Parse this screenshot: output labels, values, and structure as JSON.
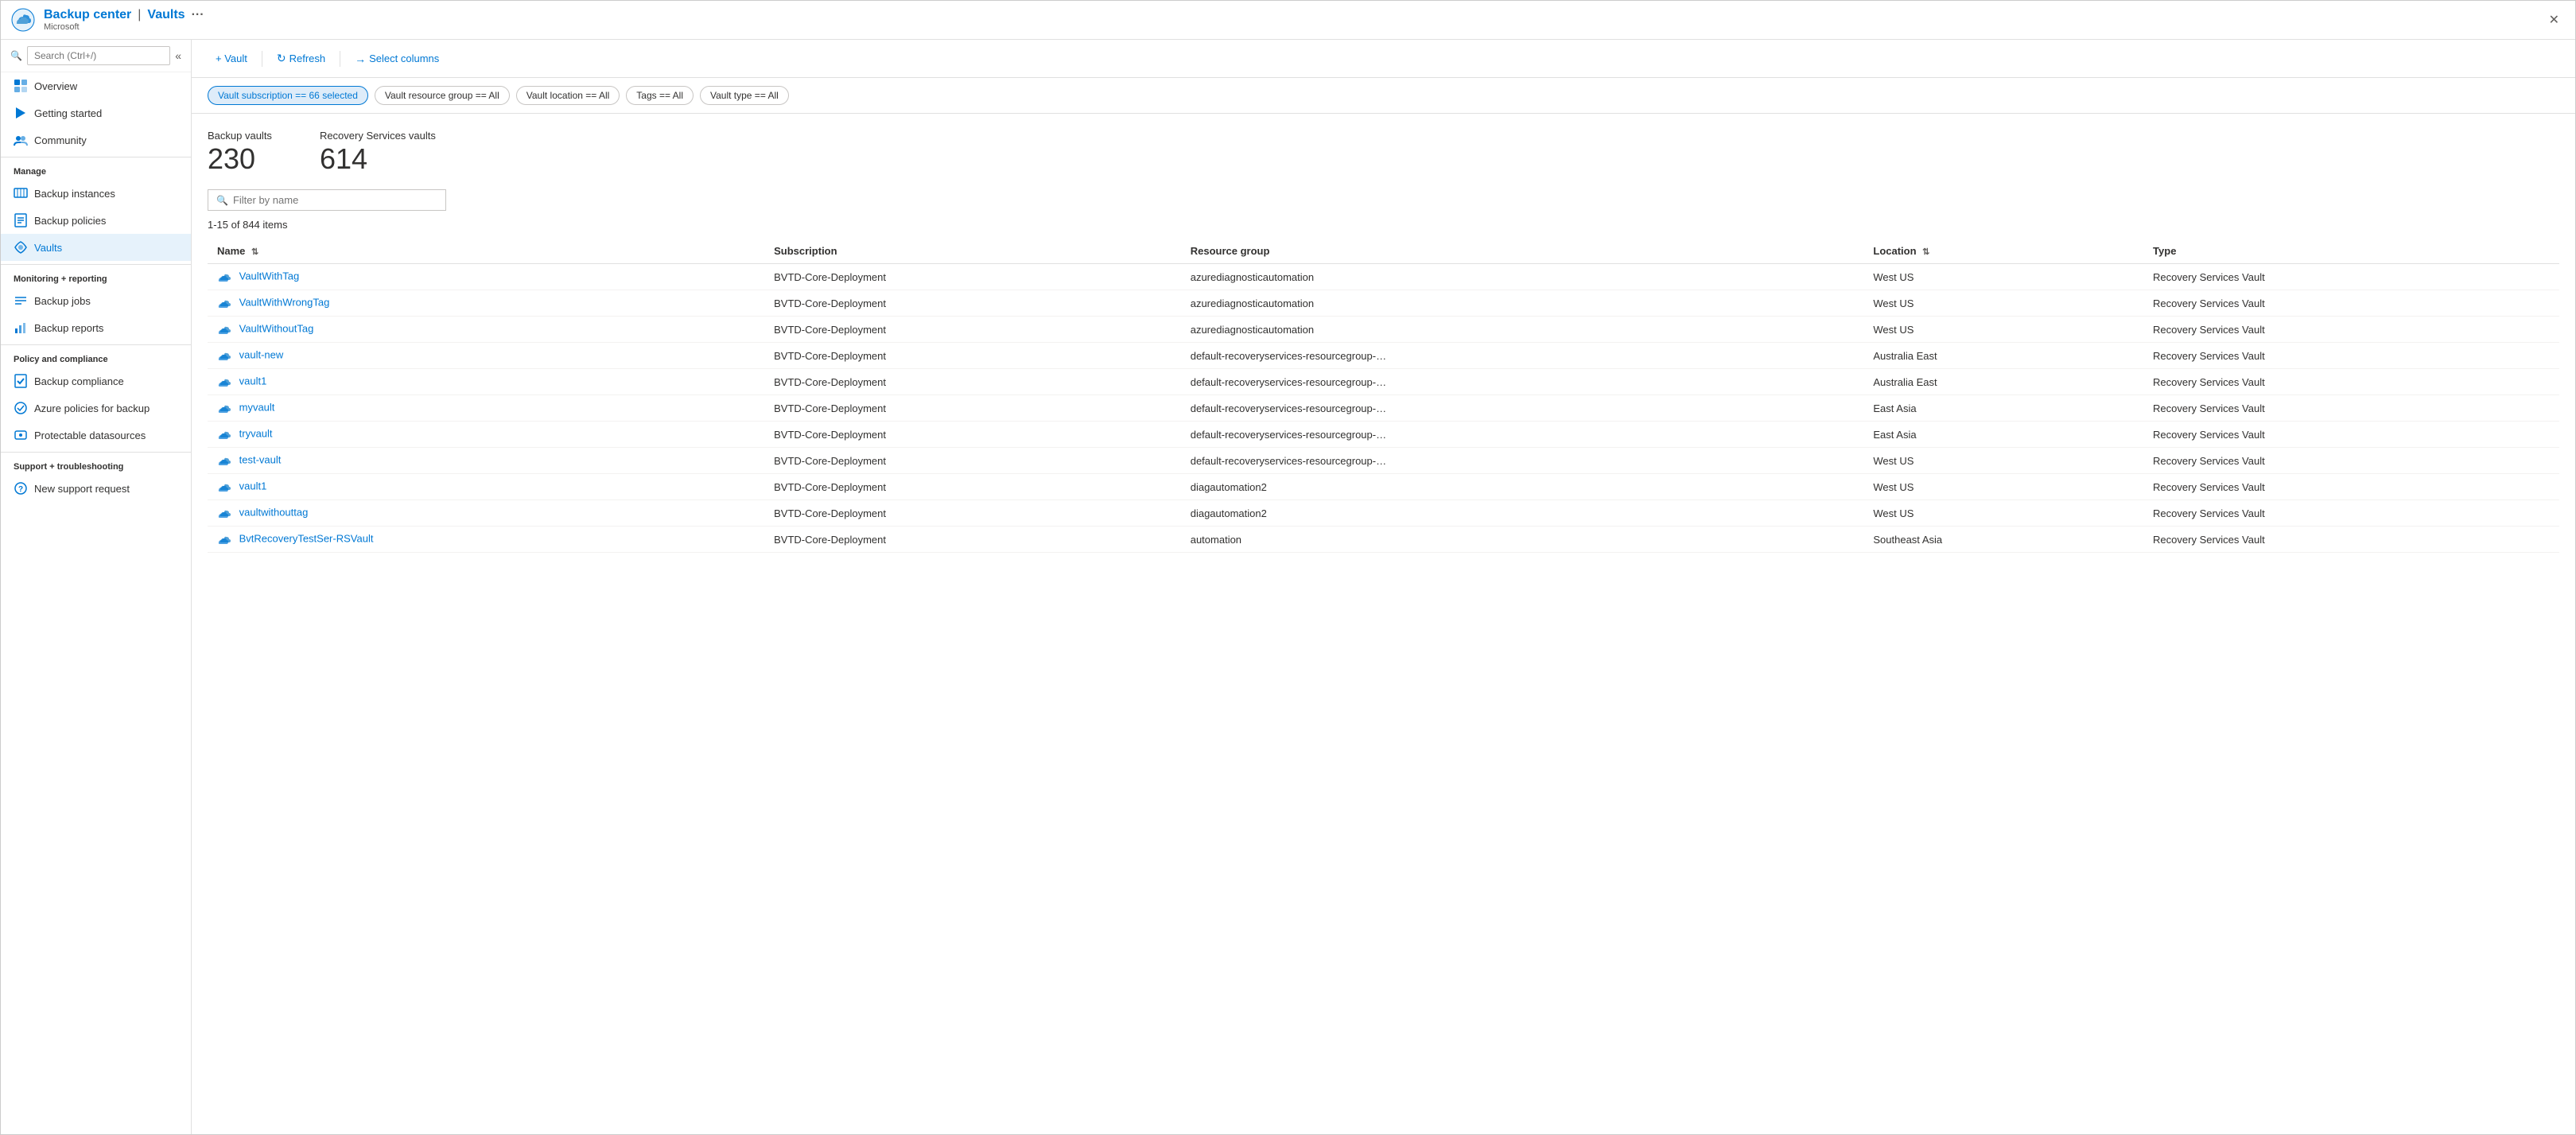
{
  "titleBar": {
    "appName": "Backup center",
    "separator": "|",
    "pageName": "Vaults",
    "ellipsis": "···",
    "subtitle": "Microsoft",
    "closeLabel": "✕"
  },
  "sidebar": {
    "searchPlaceholder": "Search (Ctrl+/)",
    "collapseIcon": "«",
    "navItems": [
      {
        "id": "overview",
        "label": "Overview",
        "iconType": "overview"
      },
      {
        "id": "getting-started",
        "label": "Getting started",
        "iconType": "getting-started"
      },
      {
        "id": "community",
        "label": "Community",
        "iconType": "community"
      }
    ],
    "sections": [
      {
        "header": "Manage",
        "items": [
          {
            "id": "backup-instances",
            "label": "Backup instances",
            "iconType": "backup-instances"
          },
          {
            "id": "backup-policies",
            "label": "Backup policies",
            "iconType": "backup-policies"
          },
          {
            "id": "vaults",
            "label": "Vaults",
            "iconType": "vaults",
            "active": true
          }
        ]
      },
      {
        "header": "Monitoring + reporting",
        "items": [
          {
            "id": "backup-jobs",
            "label": "Backup jobs",
            "iconType": "backup-jobs"
          },
          {
            "id": "backup-reports",
            "label": "Backup reports",
            "iconType": "backup-reports"
          }
        ]
      },
      {
        "header": "Policy and compliance",
        "items": [
          {
            "id": "backup-compliance",
            "label": "Backup compliance",
            "iconType": "backup-compliance"
          },
          {
            "id": "azure-policies",
            "label": "Azure policies for backup",
            "iconType": "azure-policies"
          },
          {
            "id": "protectable-datasources",
            "label": "Protectable datasources",
            "iconType": "protectable-datasources"
          }
        ]
      },
      {
        "header": "Support + troubleshooting",
        "items": [
          {
            "id": "new-support-request",
            "label": "New support request",
            "iconType": "new-support-request"
          }
        ]
      }
    ]
  },
  "toolbar": {
    "vaultLabel": "+ Vault",
    "refreshLabel": "Refresh",
    "selectColumnsLabel": "Select columns"
  },
  "filters": [
    {
      "id": "subscription",
      "label": "Vault subscription == 66 selected",
      "active": true
    },
    {
      "id": "resource-group",
      "label": "Vault resource group == All",
      "active": false
    },
    {
      "id": "location",
      "label": "Vault location == All",
      "active": false
    },
    {
      "id": "tags",
      "label": "Tags == All",
      "active": false
    },
    {
      "id": "vault-type",
      "label": "Vault type == All",
      "active": false
    }
  ],
  "stats": [
    {
      "label": "Backup vaults",
      "value": "230"
    },
    {
      "label": "Recovery Services vaults",
      "value": "614"
    }
  ],
  "filterInput": {
    "placeholder": "Filter by name"
  },
  "itemsCount": "1-15 of 844 items",
  "tableHeaders": [
    {
      "id": "name",
      "label": "Name",
      "sortable": true
    },
    {
      "id": "subscription",
      "label": "Subscription",
      "sortable": false
    },
    {
      "id": "resource-group",
      "label": "Resource group",
      "sortable": false
    },
    {
      "id": "location",
      "label": "Location",
      "sortable": true
    },
    {
      "id": "type",
      "label": "Type",
      "sortable": false
    }
  ],
  "tableRows": [
    {
      "name": "VaultWithTag",
      "subscription": "BVTD-Core-Deployment",
      "resourceGroup": "azurediagnosticautomation",
      "location": "West US",
      "type": "Recovery Services Vault"
    },
    {
      "name": "VaultWithWrongTag",
      "subscription": "BVTD-Core-Deployment",
      "resourceGroup": "azurediagnosticautomation",
      "location": "West US",
      "type": "Recovery Services Vault"
    },
    {
      "name": "VaultWithoutTag",
      "subscription": "BVTD-Core-Deployment",
      "resourceGroup": "azurediagnosticautomation",
      "location": "West US",
      "type": "Recovery Services Vault"
    },
    {
      "name": "vault-new",
      "subscription": "BVTD-Core-Deployment",
      "resourceGroup": "default-recoveryservices-resourcegroup-…",
      "location": "Australia East",
      "type": "Recovery Services Vault"
    },
    {
      "name": "vault1",
      "subscription": "BVTD-Core-Deployment",
      "resourceGroup": "default-recoveryservices-resourcegroup-…",
      "location": "Australia East",
      "type": "Recovery Services Vault"
    },
    {
      "name": "myvault",
      "subscription": "BVTD-Core-Deployment",
      "resourceGroup": "default-recoveryservices-resourcegroup-…",
      "location": "East Asia",
      "type": "Recovery Services Vault"
    },
    {
      "name": "tryvault",
      "subscription": "BVTD-Core-Deployment",
      "resourceGroup": "default-recoveryservices-resourcegroup-…",
      "location": "East Asia",
      "type": "Recovery Services Vault"
    },
    {
      "name": "test-vault",
      "subscription": "BVTD-Core-Deployment",
      "resourceGroup": "default-recoveryservices-resourcegroup-…",
      "location": "West US",
      "type": "Recovery Services Vault"
    },
    {
      "name": "vault1",
      "subscription": "BVTD-Core-Deployment",
      "resourceGroup": "diagautomation2",
      "location": "West US",
      "type": "Recovery Services Vault"
    },
    {
      "name": "vaultwithouttag",
      "subscription": "BVTD-Core-Deployment",
      "resourceGroup": "diagautomation2",
      "location": "West US",
      "type": "Recovery Services Vault"
    },
    {
      "name": "BvtRecoveryTestSer-RSVault",
      "subscription": "BVTD-Core-Deployment",
      "resourceGroup": "automation",
      "location": "Southeast Asia",
      "type": "Recovery Services Vault"
    }
  ],
  "colors": {
    "primary": "#0078d4",
    "activeNavBg": "#e6f2fb",
    "pillActiveBg": "#deecf9",
    "border": "#e0e0e0",
    "tableBorder": "#f3f2f1"
  }
}
